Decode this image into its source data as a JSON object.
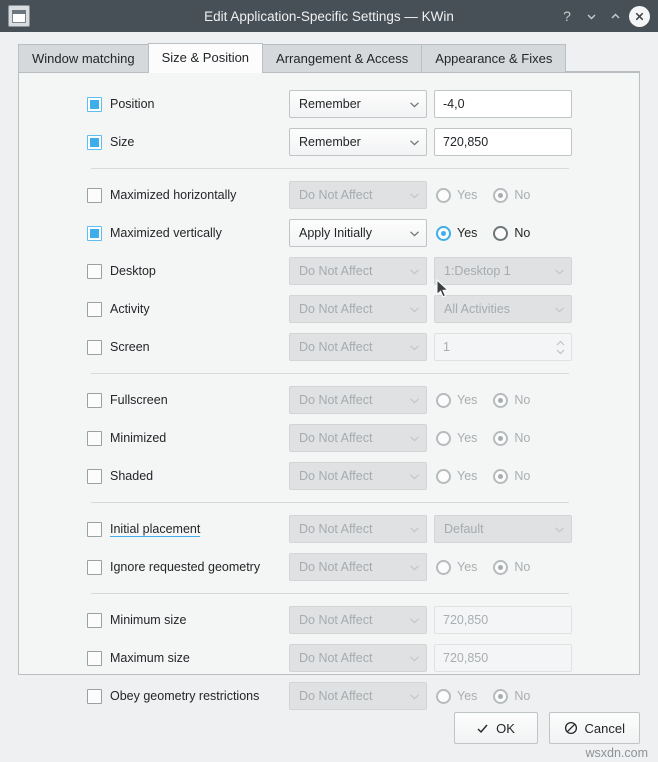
{
  "window": {
    "title": "Edit Application-Specific Settings — KWin",
    "icon": "window-settings-icon",
    "controls": {
      "help": "?",
      "minimize": "minimize-icon",
      "maximize": "maximize-icon",
      "close": "close-icon"
    }
  },
  "tabs": [
    {
      "label": "Window matching",
      "active": false
    },
    {
      "label": "Size & Position",
      "active": true
    },
    {
      "label": "Arrangement & Access",
      "active": false
    },
    {
      "label": "Appearance & Fixes",
      "active": false
    }
  ],
  "rows": [
    {
      "name": "position",
      "label": "Position",
      "checked": true,
      "combo": "Remember",
      "combo_enabled": true,
      "control": "field",
      "value": "-4,0",
      "value_enabled": true
    },
    {
      "name": "size",
      "label": "Size",
      "checked": true,
      "combo": "Remember",
      "combo_enabled": true,
      "control": "field",
      "value": "720,850",
      "value_enabled": true
    },
    {
      "name": "maximized-horizontally",
      "label": "Maximized horizontally",
      "checked": false,
      "combo": "Do Not Affect",
      "combo_enabled": false,
      "control": "radios",
      "yes_label": "Yes",
      "no_label": "No",
      "selected": "No",
      "value_enabled": false
    },
    {
      "name": "maximized-vertically",
      "label": "Maximized vertically",
      "checked": true,
      "combo": "Apply Initially",
      "combo_enabled": true,
      "control": "radios",
      "yes_label": "Yes",
      "no_label": "No",
      "selected": "Yes",
      "value_enabled": true
    },
    {
      "name": "desktop",
      "label": "Desktop",
      "checked": false,
      "combo": "Do Not Affect",
      "combo_enabled": false,
      "control": "combo2",
      "value": "1:Desktop 1",
      "value_enabled": false
    },
    {
      "name": "activity",
      "label": "Activity",
      "checked": false,
      "combo": "Do Not Affect",
      "combo_enabled": false,
      "control": "combo2",
      "value": "All Activities",
      "value_enabled": false
    },
    {
      "name": "screen",
      "label": "Screen",
      "checked": false,
      "combo": "Do Not Affect",
      "combo_enabled": false,
      "control": "spin",
      "value": "1",
      "value_enabled": false
    },
    {
      "name": "fullscreen",
      "label": "Fullscreen",
      "checked": false,
      "combo": "Do Not Affect",
      "combo_enabled": false,
      "control": "radios",
      "yes_label": "Yes",
      "no_label": "No",
      "selected": "No",
      "value_enabled": false
    },
    {
      "name": "minimized",
      "label": "Minimized",
      "checked": false,
      "combo": "Do Not Affect",
      "combo_enabled": false,
      "control": "radios",
      "yes_label": "Yes",
      "no_label": "No",
      "selected": "No",
      "value_enabled": false
    },
    {
      "name": "shaded",
      "label": "Shaded",
      "checked": false,
      "combo": "Do Not Affect",
      "combo_enabled": false,
      "control": "radios",
      "yes_label": "Yes",
      "no_label": "No",
      "selected": "No",
      "value_enabled": false
    },
    {
      "name": "initial-placement",
      "label": "Initial placement",
      "checked": false,
      "link": true,
      "combo": "Do Not Affect",
      "combo_enabled": false,
      "control": "combo2",
      "value": "Default",
      "value_enabled": false
    },
    {
      "name": "ignore-requested-geometry",
      "label": "Ignore requested geometry",
      "checked": false,
      "combo": "Do Not Affect",
      "combo_enabled": false,
      "control": "radios",
      "yes_label": "Yes",
      "no_label": "No",
      "selected": "No",
      "value_enabled": false
    },
    {
      "name": "minimum-size",
      "label": "Minimum size",
      "checked": false,
      "combo": "Do Not Affect",
      "combo_enabled": false,
      "control": "field",
      "value": "720,850",
      "value_enabled": false
    },
    {
      "name": "maximum-size",
      "label": "Maximum size",
      "checked": false,
      "combo": "Do Not Affect",
      "combo_enabled": false,
      "control": "field",
      "value": "720,850",
      "value_enabled": false
    },
    {
      "name": "obey-geometry-restrictions",
      "label": "Obey geometry restrictions",
      "checked": false,
      "combo": "Do Not Affect",
      "combo_enabled": false,
      "control": "radios",
      "yes_label": "Yes",
      "no_label": "No",
      "selected": "No",
      "value_enabled": false
    }
  ],
  "separators_after": [
    1,
    6,
    9,
    11
  ],
  "footer": {
    "ok_label": "OK",
    "cancel_label": "Cancel"
  },
  "watermark": "wsxdn.com",
  "colors": {
    "titlebar": "#475057",
    "accent": "#3daee9",
    "panel_bg": "#f4f5f5",
    "window_bg": "#eff0f1"
  }
}
